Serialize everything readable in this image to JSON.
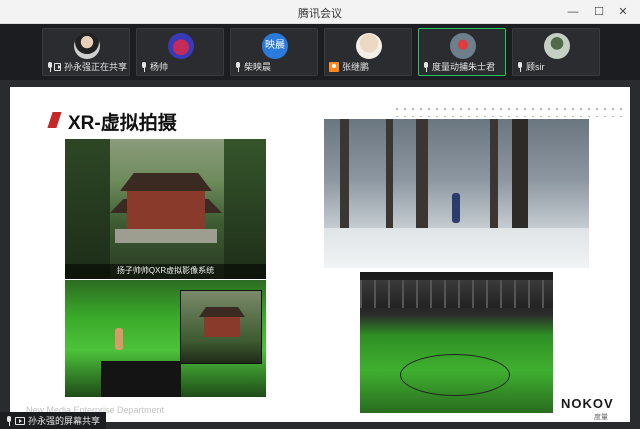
{
  "window": {
    "title": "腾讯会议",
    "minimize": "—",
    "maximize": "☐",
    "close": "✕"
  },
  "participants": [
    {
      "name": "孙永强正在共享",
      "status_icon": "mic-icon",
      "extra_icon": "share-icon",
      "avatar_text": ""
    },
    {
      "name": "杨帅",
      "status_icon": "mic-icon",
      "extra_icon": "",
      "avatar_text": ""
    },
    {
      "name": "柴映晨",
      "status_icon": "mic-icon",
      "extra_icon": "",
      "avatar_text": "映晨"
    },
    {
      "name": "张继鹏",
      "status_icon": "person-icon",
      "extra_icon": "",
      "avatar_text": ""
    },
    {
      "name": "度量动捕朱士君",
      "status_icon": "mic-icon",
      "extra_icon": "",
      "avatar_text": "",
      "active": true
    },
    {
      "name": "顾sir",
      "status_icon": "mic-icon",
      "extra_icon": "",
      "avatar_text": ""
    }
  ],
  "slide": {
    "title": "XR-虚拟拍摄",
    "photo_caption": "扬子帅帅QXR虚拟影像系统",
    "watermark": "New Media Enterprise Department",
    "logo": "NOKOV",
    "logo_sub": "度量"
  },
  "share_status": "孙永强的屏幕共享",
  "colors": {
    "accent": "#c62828",
    "active_border": "#1fc75c",
    "background": "#202124"
  }
}
